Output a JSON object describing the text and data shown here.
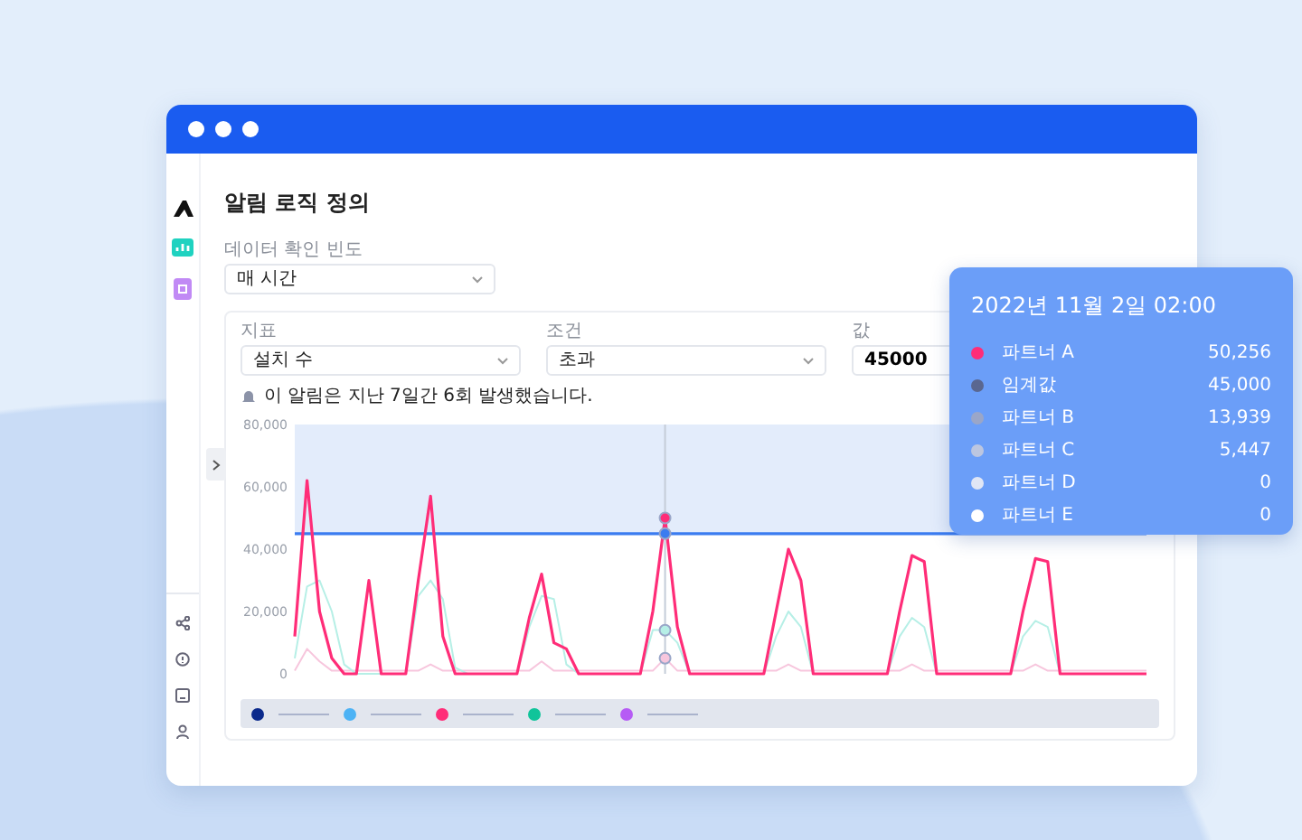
{
  "page": {
    "title": "알림 로직 정의"
  },
  "frequency": {
    "label": "데이터 확인 빈도",
    "value": "매 시간"
  },
  "condition_fields": [
    {
      "kind": "select",
      "label": "지표",
      "value": "설치 수"
    },
    {
      "kind": "select",
      "label": "조건",
      "value": "초과"
    },
    {
      "kind": "input",
      "label": "값",
      "value": "45000"
    }
  ],
  "note": "이 알림은 지난 7일간 6회 발생했습니다.",
  "chart": {
    "chart_data": {
      "type": "line",
      "ylim": [
        0,
        80000
      ],
      "bands": [
        {
          "axis": "y",
          "from": 45000,
          "to": 80000
        }
      ],
      "yticks": [
        {
          "value": 0,
          "label": "0"
        },
        {
          "value": 20000,
          "label": "20,000"
        },
        {
          "value": 40000,
          "label": "40,000"
        },
        {
          "value": 60000,
          "label": "60,000"
        },
        {
          "value": 80000,
          "label": "80,000"
        }
      ],
      "series": [
        {
          "color": "#ff2d78",
          "values": [
            12000,
            62000,
            20000,
            5000,
            0,
            0,
            30000,
            0,
            0,
            0,
            30000,
            57000,
            12000,
            0,
            0,
            0,
            0,
            0,
            0,
            18000,
            32000,
            10000,
            8000,
            0,
            0,
            0,
            0,
            0,
            0,
            20000,
            50000,
            15000,
            0,
            0,
            0,
            0,
            0,
            0,
            0,
            20000,
            40000,
            30000,
            0,
            0,
            0,
            0,
            0,
            0,
            0,
            20000,
            38000,
            36000,
            0,
            0,
            0,
            0,
            0,
            0,
            0,
            20000,
            37000,
            36000,
            0,
            0,
            0,
            0,
            0,
            0,
            0,
            0
          ]
        },
        {
          "color": "#3b7cf0",
          "values": [
            45000,
            45000,
            45000,
            45000,
            45000,
            45000,
            45000,
            45000,
            45000,
            45000,
            45000,
            45000,
            45000,
            45000,
            45000,
            45000,
            45000,
            45000,
            45000,
            45000,
            45000,
            45000,
            45000,
            45000,
            45000,
            45000,
            45000,
            45000,
            45000,
            45000,
            45000,
            45000,
            45000,
            45000,
            45000,
            45000,
            45000,
            45000,
            45000,
            45000,
            45000,
            45000,
            45000,
            45000,
            45000,
            45000,
            45000,
            45000,
            45000,
            45000,
            45000,
            45000,
            45000,
            45000,
            45000,
            45000,
            45000,
            45000,
            45000,
            45000,
            45000,
            45000,
            45000,
            45000,
            45000,
            45000,
            45000,
            45000,
            45000,
            45000
          ]
        },
        {
          "color": "#b6efe6",
          "values": [
            5000,
            28000,
            30000,
            20000,
            3000,
            0,
            0,
            0,
            0,
            0,
            25000,
            30000,
            24000,
            2000,
            0,
            0,
            0,
            0,
            0,
            15000,
            25000,
            24000,
            3000,
            0,
            0,
            0,
            0,
            0,
            0,
            14000,
            14000,
            10000,
            0,
            0,
            0,
            0,
            0,
            0,
            0,
            12000,
            20000,
            15000,
            0,
            0,
            0,
            0,
            0,
            0,
            0,
            12000,
            18000,
            15000,
            0,
            0,
            0,
            0,
            0,
            0,
            0,
            12000,
            17000,
            15000,
            0,
            null,
            null,
            null,
            null,
            null,
            null,
            null
          ]
        },
        {
          "color": "#f7c6dd",
          "values": [
            1000,
            8000,
            4000,
            1000,
            1000,
            1000,
            1000,
            1000,
            1000,
            1000,
            1000,
            3000,
            1000,
            1000,
            1000,
            1000,
            1000,
            1000,
            1000,
            1000,
            4000,
            1000,
            1000,
            1000,
            1000,
            1000,
            1000,
            1000,
            1000,
            1000,
            5000,
            1000,
            1000,
            1000,
            1000,
            1000,
            1000,
            1000,
            1000,
            1000,
            3000,
            1000,
            1000,
            1000,
            1000,
            1000,
            1000,
            1000,
            1000,
            1000,
            3000,
            1000,
            1000,
            1000,
            1000,
            1000,
            1000,
            1000,
            1000,
            1000,
            3000,
            1000,
            1000,
            1000,
            1000,
            1000,
            1000,
            1000,
            1000,
            1000
          ]
        }
      ]
    },
    "legend": [
      {
        "color": "#0b2a8c"
      },
      {
        "color": "#4db3f5"
      },
      {
        "color": "#ff2d78"
      },
      {
        "color": "#10c49a"
      },
      {
        "color": "#b65cf5"
      }
    ]
  },
  "tooltip": {
    "title": "2022년 11월 2일 02:00",
    "rows": [
      {
        "label": "파트너 A",
        "value": "50,256",
        "color": "#ff2d78"
      },
      {
        "label": "임계값",
        "value": "45,000",
        "color": "#5a6790"
      },
      {
        "label": "파트너 B",
        "value": "13,939",
        "color": "#9aa6c8"
      },
      {
        "label": "파트너 C",
        "value": "5,447",
        "color": "#bcc6e0"
      },
      {
        "label": "파트너 D",
        "value": "0",
        "color": "#e0e6f5"
      },
      {
        "label": "파트너 E",
        "value": "0",
        "color": "#ffffff"
      }
    ]
  }
}
